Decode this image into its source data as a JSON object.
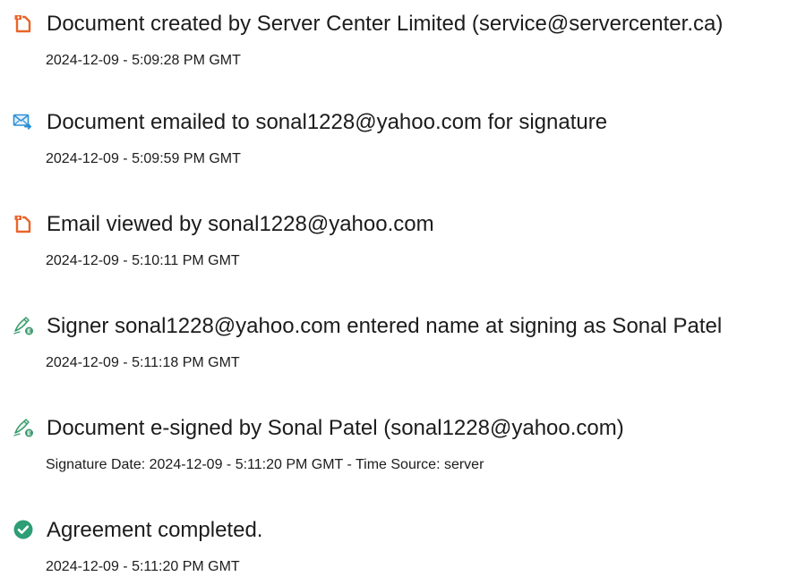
{
  "events": [
    {
      "icon": "document-icon",
      "title": "Document created by Server Center Limited (service@servercenter.ca)",
      "time": "2024-12-09 - 5:09:28 PM GMT"
    },
    {
      "icon": "email-send-icon",
      "title": "Document emailed to sonal1228@yahoo.com for signature",
      "time": "2024-12-09 - 5:09:59 PM GMT"
    },
    {
      "icon": "document-icon",
      "title": "Email viewed by sonal1228@yahoo.com",
      "time": "2024-12-09 - 5:10:11 PM GMT"
    },
    {
      "icon": "pen-sign-icon",
      "title": "Signer sonal1228@yahoo.com entered name at signing as Sonal Patel",
      "time": "2024-12-09 - 5:11:18 PM GMT"
    },
    {
      "icon": "pen-sign-icon",
      "title": "Document e-signed by Sonal Patel (sonal1228@yahoo.com)",
      "time": "Signature Date: 2024-12-09 - 5:11:20 PM GMT - Time Source: server"
    },
    {
      "icon": "check-circle-icon",
      "title": "Agreement completed.",
      "time": "2024-12-09 - 5:11:20 PM GMT"
    }
  ],
  "colors": {
    "document_icon": "#e8652a",
    "email_icon": "#2b8fd6",
    "sign_icon": "#3a9b6c",
    "check_icon": "#2e9e77"
  }
}
